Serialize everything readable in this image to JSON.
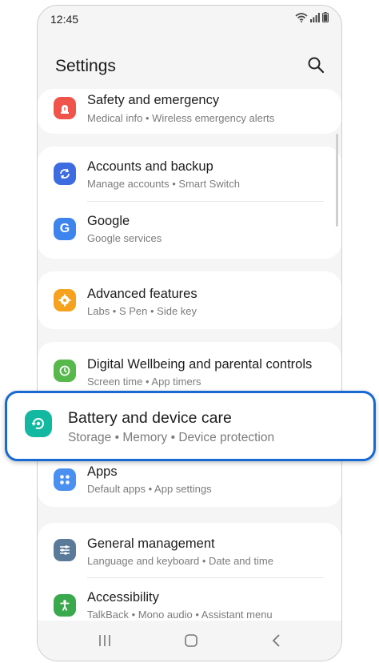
{
  "status": {
    "time": "12:45"
  },
  "header": {
    "title": "Settings"
  },
  "items": {
    "safety": {
      "label": "Safety and emergency",
      "sub": "Medical info  •  Wireless emergency alerts",
      "icon": "siren-icon",
      "color": "#f0534a"
    },
    "accounts": {
      "label": "Accounts and backup",
      "sub": "Manage accounts  •  Smart Switch",
      "icon": "sync-icon",
      "color": "#3d6be0"
    },
    "google": {
      "label": "Google",
      "sub": "Google services",
      "icon": "google-icon",
      "color": "#3d84ee"
    },
    "advanced": {
      "label": "Advanced features",
      "sub": "Labs  •  S Pen  •  Side key",
      "icon": "gear-plus-icon",
      "color": "#f6a21e"
    },
    "wellbeing": {
      "label": "Digital Wellbeing and parental controls",
      "sub": "Screen time  •  App timers",
      "icon": "wellbeing-icon",
      "color": "#57b84b"
    },
    "battery": {
      "label": "Battery and device care",
      "sub": "Storage  •  Memory  •  Device protection",
      "icon": "device-care-icon",
      "color": "#13b8a0"
    },
    "apps": {
      "label": "Apps",
      "sub": "Default apps  •  App settings",
      "icon": "apps-icon",
      "color": "#4a90f0"
    },
    "general": {
      "label": "General management",
      "sub": "Language and keyboard  •  Date and time",
      "icon": "sliders-icon",
      "color": "#5a7a99"
    },
    "accessibility": {
      "label": "Accessibility",
      "sub": "TalkBack  •  Mono audio  •  Assistant menu",
      "icon": "accessibility-icon",
      "color": "#3aa84c"
    }
  },
  "accent": "#1769d4"
}
